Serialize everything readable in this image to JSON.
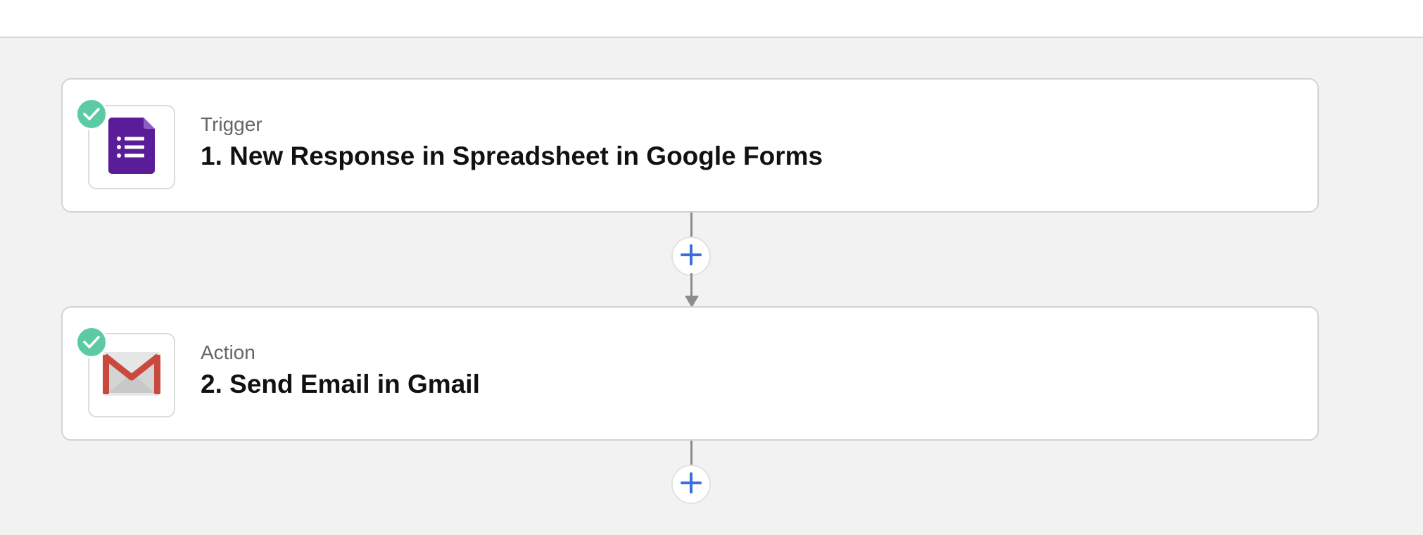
{
  "steps": [
    {
      "kind": "Trigger",
      "title": "1. New Response in Spreadsheet in Google Forms",
      "app_icon": "google-forms-icon",
      "status_icon": "check-icon"
    },
    {
      "kind": "Action",
      "title": "2. Send Email in Gmail",
      "app_icon": "gmail-icon",
      "status_icon": "check-icon"
    }
  ],
  "add_step": {
    "icon": "plus-icon"
  },
  "colors": {
    "canvas": "#f2f2f2",
    "check_badge": "#5ccba4",
    "plus": "#3b6fde",
    "forms_purple": "#5b1c9a",
    "gmail_red": "#c9493f",
    "connector": "#8c8c8c"
  }
}
